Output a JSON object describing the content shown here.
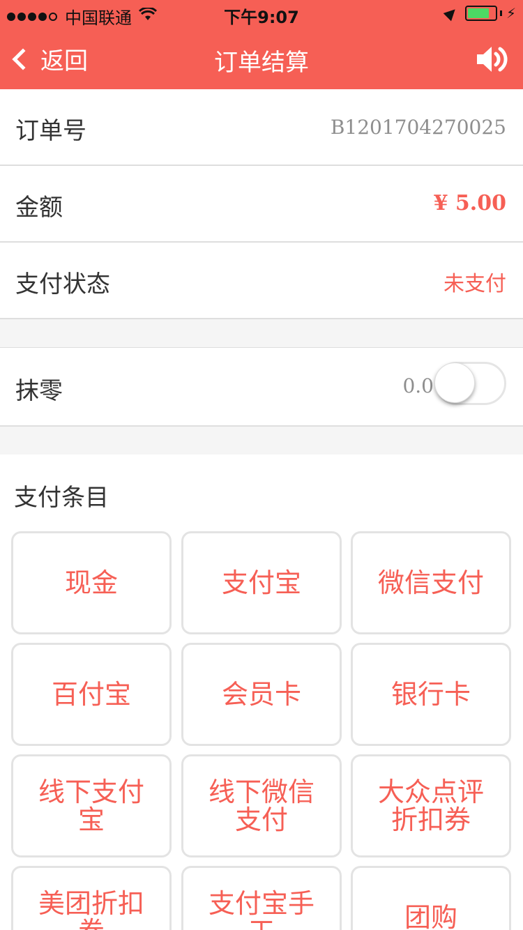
{
  "status_bar": {
    "carrier": "中国联通",
    "time": "下午9:07"
  },
  "nav": {
    "back_label": "返回",
    "title": "订单结算",
    "speaker_icon": "speaker-icon"
  },
  "order": {
    "number_label": "订单号",
    "number_value": "B1201704270025",
    "amount_label": "金额",
    "amount_value": "¥ 5.00",
    "status_label": "支付状态",
    "status_value": "未支付"
  },
  "rounding": {
    "label": "抹零",
    "value": "0.0",
    "enabled": false
  },
  "payment_items": {
    "title": "支付条目",
    "items": [
      {
        "label": "现金"
      },
      {
        "label": "支付宝"
      },
      {
        "label": "微信支付"
      },
      {
        "label": "百付宝"
      },
      {
        "label": "会员卡"
      },
      {
        "label": "银行卡"
      },
      {
        "label": "线下支付宝"
      },
      {
        "label": "线下微信支付"
      },
      {
        "label": "大众点评折扣券"
      },
      {
        "label": "美团折扣券"
      },
      {
        "label": "支付宝手工"
      },
      {
        "label": "团购"
      }
    ]
  },
  "colors": {
    "brand": "#f65f55",
    "muted_text": "#8e8e8e"
  }
}
